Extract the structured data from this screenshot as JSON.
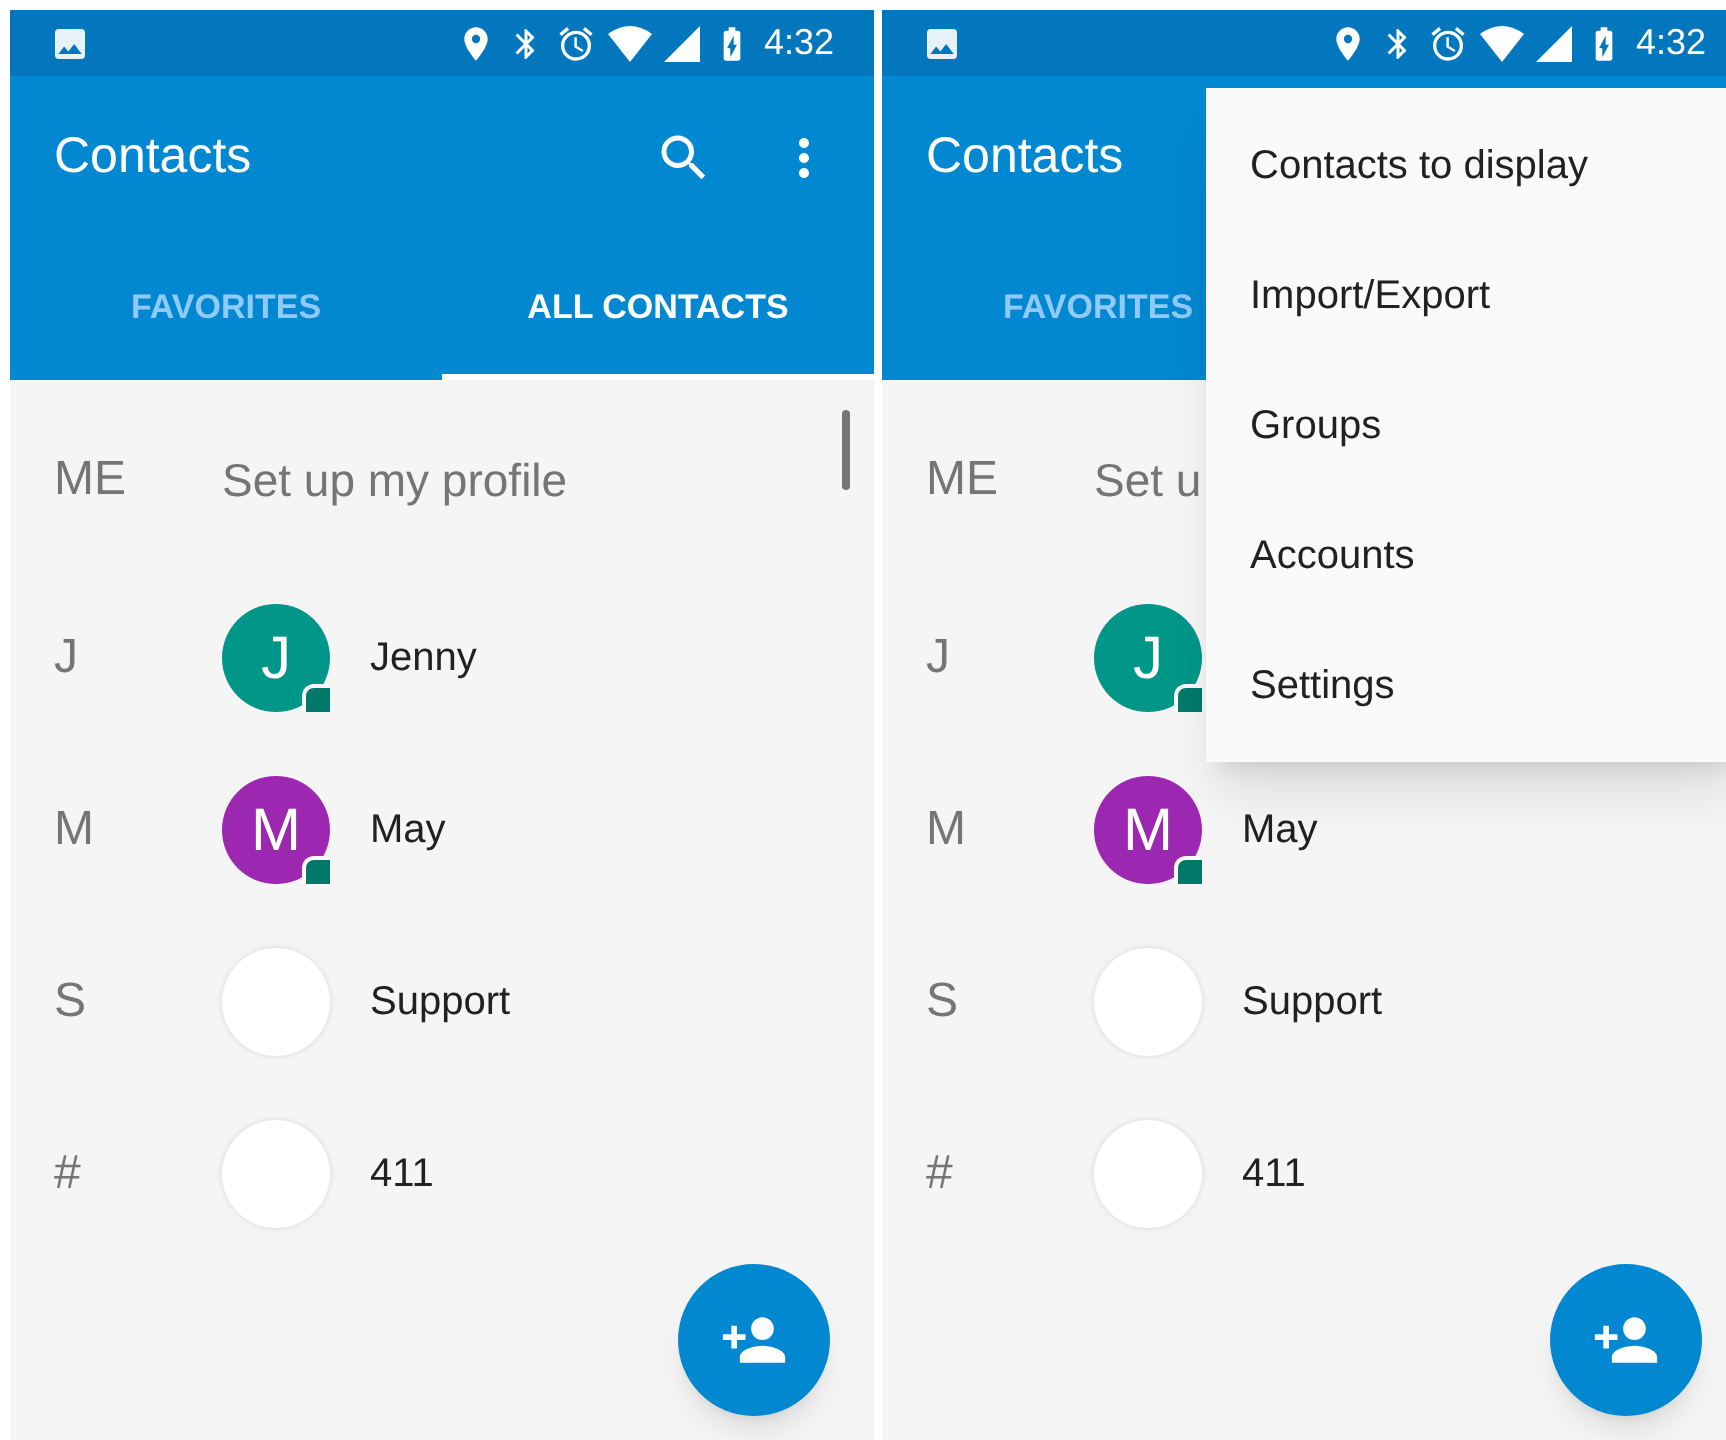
{
  "screens": [
    {
      "status_bar": {
        "time": "4:32"
      },
      "toolbar": {
        "title": "Contacts",
        "actions": [
          {
            "kind": "search"
          },
          {
            "kind": "more"
          }
        ]
      },
      "tabs": [
        {
          "label": "FAVORITES",
          "selected": false
        },
        {
          "label": "ALL CONTACTS",
          "selected": true
        }
      ],
      "me_row": {
        "label": "ME",
        "text": "Set up my profile"
      },
      "contacts": [
        {
          "section": "J",
          "name": "Jenny",
          "avatar": {
            "kind": "letter",
            "initial": "J",
            "color": "#009688"
          }
        },
        {
          "section": "M",
          "name": "May",
          "avatar": {
            "kind": "letter",
            "initial": "M",
            "color": "#9c27b0"
          }
        },
        {
          "section": "S",
          "name": "Support",
          "avatar": {
            "kind": "blank"
          }
        },
        {
          "section": "#",
          "name": "411",
          "avatar": {
            "kind": "blank"
          }
        }
      ]
    },
    {
      "status_bar": {
        "time": "4:32"
      },
      "toolbar": {
        "title": "Contacts"
      },
      "tabs": [
        {
          "label": "FAVORITES",
          "selected": false
        }
      ],
      "me_row": {
        "label": "ME",
        "text": "Set u"
      },
      "contacts": [
        {
          "section": "J",
          "avatar": {
            "kind": "letter",
            "initial": "J",
            "color": "#009688"
          }
        },
        {
          "section": "M",
          "name": "May",
          "avatar": {
            "kind": "letter",
            "initial": "M",
            "color": "#9c27b0"
          }
        },
        {
          "section": "S",
          "name": "Support",
          "avatar": {
            "kind": "blank"
          }
        },
        {
          "section": "#",
          "name": "411",
          "avatar": {
            "kind": "blank"
          }
        }
      ],
      "menu": [
        "Contacts to display",
        "Import/Export",
        "Groups",
        "Accounts",
        "Settings"
      ]
    }
  ]
}
